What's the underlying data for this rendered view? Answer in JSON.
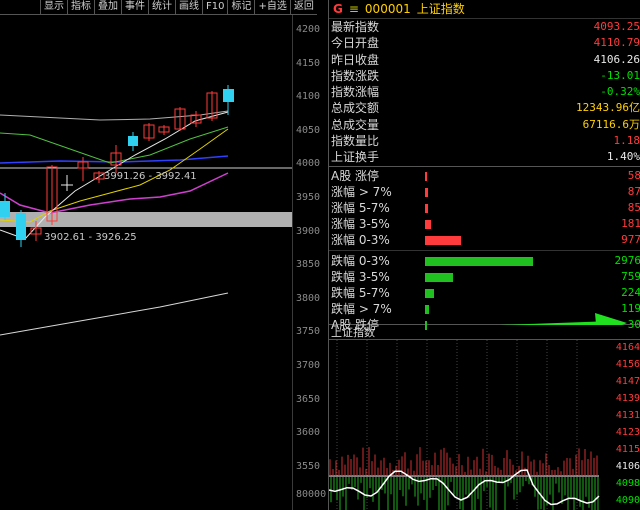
{
  "toolbar": {
    "items": [
      "显示",
      "指标",
      "叠加",
      "事件",
      "统计",
      "画线",
      "F10",
      "标记",
      "+自选",
      "返回"
    ]
  },
  "kline": {
    "price_ticks": [
      "4200",
      "4150",
      "4100",
      "4050",
      "4000",
      "3950",
      "3900",
      "3850",
      "3800",
      "3750",
      "3700",
      "3650",
      "3600",
      "3550"
    ],
    "volume_tick": "80000",
    "annotation_high": "3991.26 - 3992.41",
    "annotation_low": "3902.61 - 3926.25"
  },
  "header": {
    "flag": "G",
    "menu_glyph": "≡",
    "code": "000001",
    "name": "上证指数"
  },
  "stats": [
    {
      "label": "最新指数",
      "value": "4093.25",
      "color": "red"
    },
    {
      "label": "今日开盘",
      "value": "4110.79",
      "color": "red"
    },
    {
      "label": "昨日收盘",
      "value": "4106.26",
      "color": "white"
    },
    {
      "label": "指数涨跌",
      "value": "-13.01",
      "color": "green"
    },
    {
      "label": "指数涨幅",
      "value": "-0.32%",
      "color": "green"
    },
    {
      "label": "总成交额",
      "value": "12343.96亿",
      "color": "yellow"
    },
    {
      "label": "总成交量",
      "value": "67116.6万",
      "color": "yellow"
    },
    {
      "label": "指数量比",
      "value": "1.18",
      "color": "red"
    },
    {
      "label": "上证换手",
      "value": "1.40%",
      "color": "white"
    }
  ],
  "distribution": {
    "up": [
      {
        "label": "A股 涨停",
        "count": "58",
        "ratio": 0.02
      },
      {
        "label": "涨幅 > 7%",
        "count": "87",
        "ratio": 0.03
      },
      {
        "label": "涨幅 5-7%",
        "count": "85",
        "ratio": 0.03
      },
      {
        "label": "涨幅 3-5%",
        "count": "181",
        "ratio": 0.06
      },
      {
        "label": "涨幅 0-3%",
        "count": "977",
        "ratio": 0.33
      }
    ],
    "down": [
      {
        "label": "跌幅 0-3%",
        "count": "2976",
        "ratio": 1.0
      },
      {
        "label": "跌幅 3-5%",
        "count": "759",
        "ratio": 0.26
      },
      {
        "label": "跌幅 5-7%",
        "count": "224",
        "ratio": 0.08
      },
      {
        "label": "跌幅 > 7%",
        "count": "119",
        "ratio": 0.04
      },
      {
        "label": "A股 跌停",
        "count": "30",
        "ratio": 0.01
      }
    ],
    "up_color": "#ff3b3b",
    "down_color": "#20c020",
    "arrow_color": "#20e020"
  },
  "mini_chart": {
    "title": "上证指数",
    "ticks": [
      {
        "text": "4164",
        "color": "red"
      },
      {
        "text": "4156",
        "color": "red"
      },
      {
        "text": "4147",
        "color": "red"
      },
      {
        "text": "4139",
        "color": "red"
      },
      {
        "text": "4131",
        "color": "red"
      },
      {
        "text": "4123",
        "color": "red"
      },
      {
        "text": "4115",
        "color": "red"
      },
      {
        "text": "4106",
        "color": "white"
      },
      {
        "text": "4098",
        "color": "green"
      },
      {
        "text": "4090",
        "color": "green"
      }
    ]
  }
}
